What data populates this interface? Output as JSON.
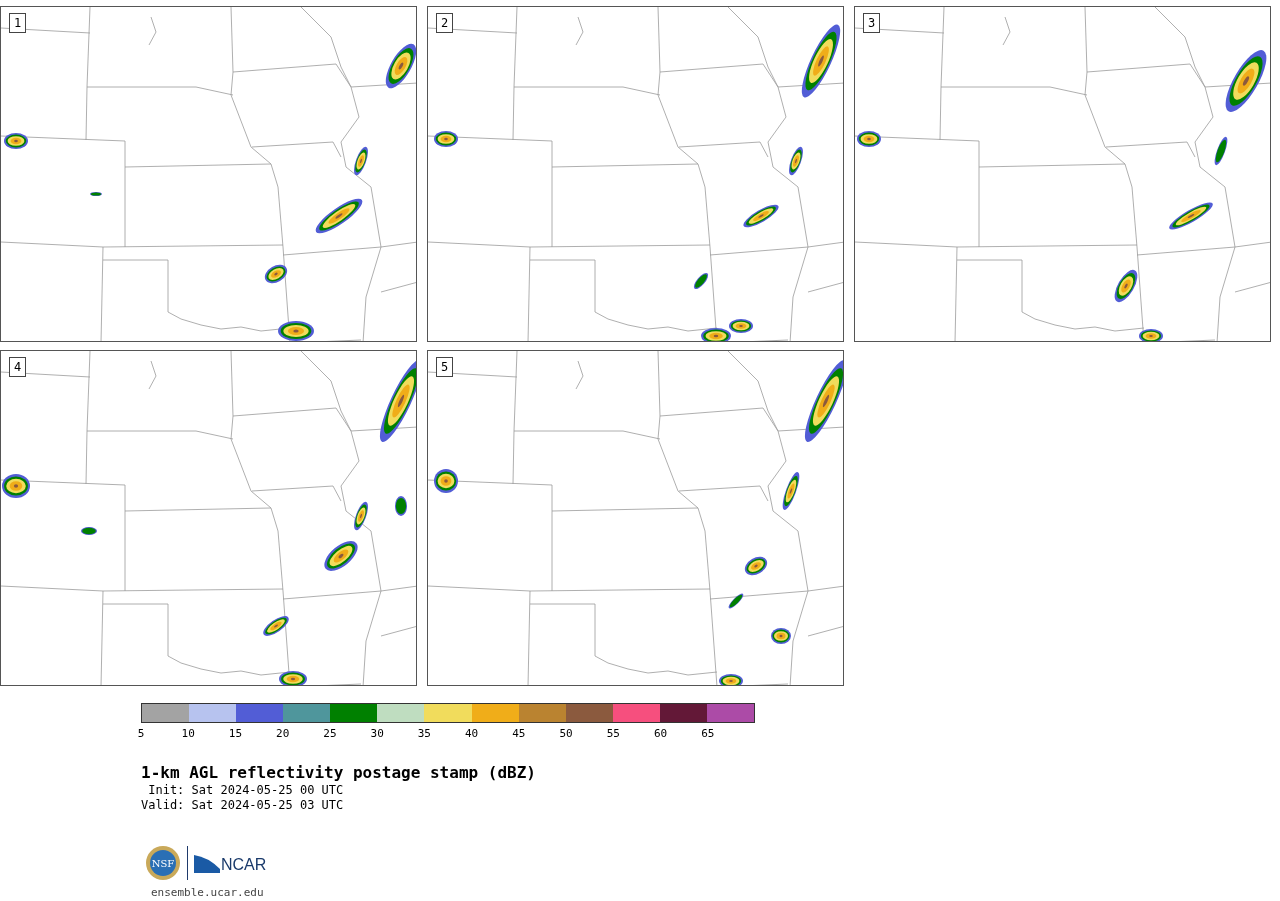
{
  "panels": [
    {
      "label": "1"
    },
    {
      "label": "2"
    },
    {
      "label": "3"
    },
    {
      "label": "4"
    },
    {
      "label": "5"
    }
  ],
  "colorbar": {
    "bins": [
      {
        "color": "#a3a3a3"
      },
      {
        "color": "#b7c3ef"
      },
      {
        "color": "#525dd6"
      },
      {
        "color": "#4f969c"
      },
      {
        "color": "#008000"
      },
      {
        "color": "#bfddc0"
      },
      {
        "color": "#f1dc5c"
      },
      {
        "color": "#f0ad19"
      },
      {
        "color": "#ba8330"
      },
      {
        "color": "#8b5a3e"
      },
      {
        "color": "#f64f7e"
      },
      {
        "color": "#631837"
      },
      {
        "color": "#ac4ba7"
      }
    ],
    "ticks": [
      "5",
      "10",
      "15",
      "20",
      "25",
      "30",
      "35",
      "40",
      "45",
      "50",
      "55",
      "60",
      "65"
    ]
  },
  "title": "1-km AGL reflectivity postage stamp (dBZ)",
  "init": " Init: Sat 2024-05-25 00 UTC",
  "valid": "Valid: Sat 2024-05-25 03 UTC",
  "logo": {
    "nsf_text": "NSF",
    "ncar_text": "NCAR"
  },
  "url": "ensemble.ucar.edu"
}
